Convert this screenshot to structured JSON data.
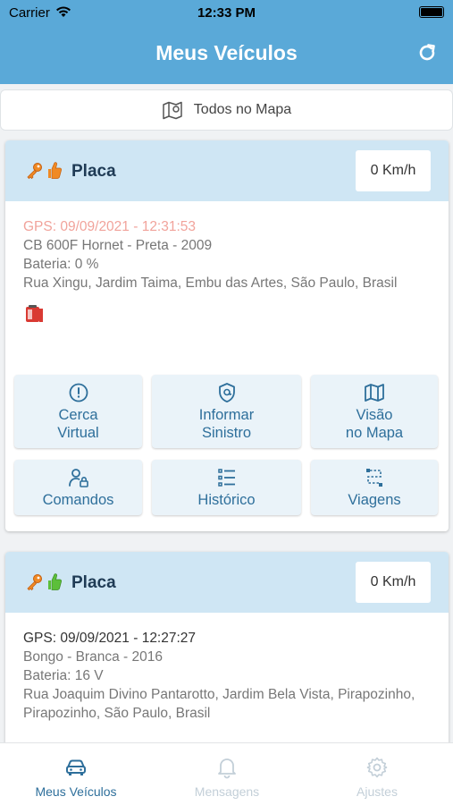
{
  "status_bar": {
    "carrier": "Carrier",
    "time": "12:33 PM"
  },
  "header": {
    "title": "Meus Veículos"
  },
  "map_button": {
    "label": "Todos no Mapa"
  },
  "vehicles": [
    {
      "plate": "Placa",
      "speed": "0 Km/h",
      "gps": "GPS: 09/09/2021 - 12:31:53",
      "model": "CB 600F Hornet - Preta - 2009",
      "battery": "Bateria: 0 %",
      "address": "Rua Xingu, Jardim Taima, Embu das Artes, São Paulo, Brasil"
    },
    {
      "plate": "Placa",
      "speed": "0 Km/h",
      "gps": "GPS: 09/09/2021 - 12:27:27",
      "model": "Bongo - Branca - 2016",
      "battery": "Bateria: 16 V",
      "address": "Rua Joaquim Divino Pantarotto, Jardim Bela Vista, Pirapozinho, Pirapozinho, São Paulo, Brasil"
    }
  ],
  "actions": {
    "cerca_line1": "Cerca",
    "cerca_line2": "Virtual",
    "sinistro_line1": "Informar",
    "sinistro_line2": "Sinistro",
    "visao_line1": "Visão",
    "visao_line2": "no Mapa",
    "comandos": "Comandos",
    "historico": "Histórico",
    "viagens": "Viagens"
  },
  "tabs": [
    {
      "label": "Meus Veículos"
    },
    {
      "label": "Mensagens"
    },
    {
      "label": "Ajustes"
    }
  ],
  "colors": {
    "header": "#5aa9d8",
    "card_header": "#cfe6f4",
    "accent": "#2e6f9b",
    "gps_stale": "#f1a39b",
    "thumb_orange": "#f08a24",
    "thumb_green": "#5cbf3a"
  }
}
